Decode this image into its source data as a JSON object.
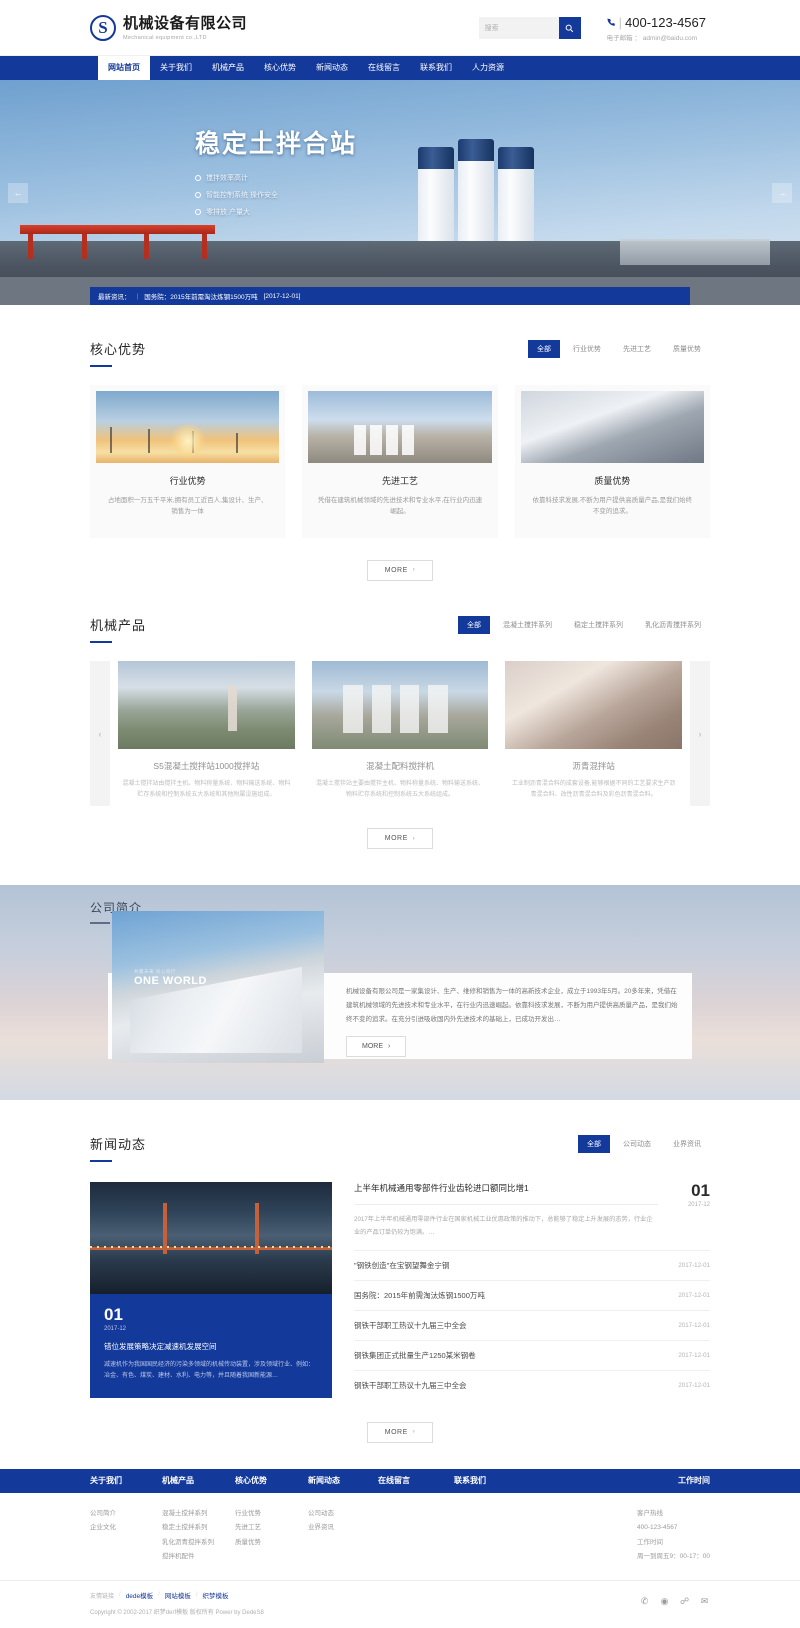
{
  "brand": {
    "logo_letter": "S",
    "name_cn": "机械设备有限公司",
    "name_en": "Mechanical equipment co.,LTD"
  },
  "search": {
    "placeholder": "搜索",
    "icon": "search-icon"
  },
  "contact": {
    "phone_icon": "phone-icon",
    "phone": "400-123-4567",
    "email_label": "电子邮箱",
    "email": "admin@baidu.com"
  },
  "nav": {
    "items": [
      {
        "label": "网站首页",
        "active": true
      },
      {
        "label": "关于我们",
        "active": false
      },
      {
        "label": "机械产品",
        "active": false
      },
      {
        "label": "核心优势",
        "active": false
      },
      {
        "label": "新闻动态",
        "active": false
      },
      {
        "label": "在线留言",
        "active": false
      },
      {
        "label": "联系我们",
        "active": false
      },
      {
        "label": "人力资源",
        "active": false
      }
    ]
  },
  "banner": {
    "title": "稳定土拌合站",
    "features": [
      "搅拌效率高计",
      "智能控制系统 操作安全",
      "零排放 产量大"
    ],
    "prev_icon": "arrow-left-icon",
    "prev_label": "←",
    "next_icon": "arrow-right-icon",
    "next_label": "→"
  },
  "ticker": {
    "label": "最新资讯：",
    "headline": "国务院：2015年前需淘汰炼钢1500万吨",
    "date": "[2017-12-01]"
  },
  "advantages": {
    "title": "核心优势",
    "tabs": [
      {
        "label": "全部",
        "active": true
      },
      {
        "label": "行业优势",
        "active": false
      },
      {
        "label": "先进工艺",
        "active": false
      },
      {
        "label": "质量优势",
        "active": false
      }
    ],
    "cards": [
      {
        "title": "行业优势",
        "desc": "占地面积一万五千平米,拥有员工近百人,集设计、生产、销售为一体"
      },
      {
        "title": "先进工艺",
        "desc": "凭借在建筑机械领域的先进技术和专业水平,在行业内迅速崛起。"
      },
      {
        "title": "质量优势",
        "desc": "依靠科技求发展,不断为用户提供高质量产品,是我们始终不变的追求。"
      }
    ],
    "more_label": "MORE"
  },
  "products": {
    "title": "机械产品",
    "tabs": [
      {
        "label": "全部",
        "active": true
      },
      {
        "label": "混凝土搅拌系列",
        "active": false
      },
      {
        "label": "稳定土搅拌系列",
        "active": false
      },
      {
        "label": "乳化沥青搅拌系列",
        "active": false
      }
    ],
    "prev_label": "‹",
    "next_label": "›",
    "items": [
      {
        "title": "S5混凝土搅拌站1000搅拌站",
        "desc": "混凝土搅拌站由搅拌主机、物料称量系统、物料输送系统、物料贮存系统和控制系统五大系统和其他附属设施组成。"
      },
      {
        "title": "混凝土配料搅拌机",
        "desc": "混凝土搅拌站主要由搅拌主机、物料称量系统、物料输送系统、物料贮存系统和控制系统五大系统组成。"
      },
      {
        "title": "沥青混拌站",
        "desc": "工业制沥青混合料的成套设备,能够根据不同的工艺要求生产沥青混合料、改性沥青混合料及彩色沥青混合料。"
      }
    ],
    "more_label": "MORE"
  },
  "about": {
    "title": "公司简介",
    "photo_sub": "共赢未来 同心同行",
    "photo_title": "ONE WORLD",
    "text": "机械设备有限公司是一家集设计、生产、维修和销售为一体的高新技术企业，成立于1993年5月。20多年来，凭借在建筑机械领域的先进技术和专业水平，在行业内迅速崛起。依靠科技求发展，不断为用户提供高质量产品，是我们始终不变的追求。在充分引进吸收国内外先进技术的基础上，已成功开发出…",
    "more_label": "MORE"
  },
  "news": {
    "title": "新闻动态",
    "tabs": [
      {
        "label": "全部",
        "active": true
      },
      {
        "label": "公司动态",
        "active": false
      },
      {
        "label": "业界资讯",
        "active": false
      }
    ],
    "featured": {
      "day": "01",
      "year_month": "2017-12",
      "title": "错位发展策略决定减速机发展空间",
      "desc": "减速机作为我国国民经济的污染多领域的机械传动装置，涉及领域行业、例如：冶金、有色、煤炭、建材、水利、电力等，并且随着我国新能源…"
    },
    "top": {
      "title": "上半年机械通用零部件行业齿轮进口额同比增1",
      "desc": "2017年上半年机械通用零部件行业在国家机械工业优惠政策的推动下，总能够了稳定上升发展的态势，行业企业的产品订单仍较为饱满。…",
      "day": "01",
      "year_month": "2017-12"
    },
    "list": [
      {
        "title": "\"钢铁创造\"在宝钢望舞金宁钢",
        "date": "2017-12-01"
      },
      {
        "title": "国务院：2015年前需淘汰炼钢1500万吨",
        "date": "2017-12-01"
      },
      {
        "title": "钢铁干部职工热议十九届三中全会",
        "date": "2017-12-01"
      },
      {
        "title": "钢铁集团正式批量生产1250某米钢卷",
        "date": "2017-12-01"
      },
      {
        "title": "钢铁干部职工热议十九届三中全会",
        "date": "2017-12-01"
      }
    ],
    "more_label": "MORE"
  },
  "footer": {
    "nav": [
      "关于我们",
      "机械产品",
      "核心优势",
      "新闻动态",
      "在线留言",
      "联系我们"
    ],
    "hours_heading": "工作时间",
    "columns": [
      {
        "links": [
          "公司简介",
          "企业文化"
        ]
      },
      {
        "links": [
          "混凝土搅拌系列",
          "稳定土搅拌系列",
          "乳化沥青搅拌系列",
          "搅拌机配件"
        ]
      },
      {
        "links": [
          "行业优势",
          "先进工艺",
          "质量优势"
        ]
      },
      {
        "links": [
          "公司动态",
          "业界资讯"
        ]
      },
      {
        "links": []
      },
      {
        "links": []
      }
    ],
    "hours": {
      "line1": "客户热线",
      "line2": "400-123-4567",
      "line3": "工作时间",
      "line4": "周一到周五9：00-17：00"
    },
    "friend_label": "友情链接",
    "friend_links": [
      "dede模板",
      "网站模板",
      "织梦模板"
    ],
    "copyright": "Copyright © 2002-2017 织梦derf模板 版权所有  Power by DedeS8",
    "social": [
      {
        "icon": "wechat-icon",
        "glyph": "✆"
      },
      {
        "icon": "weibo-icon",
        "glyph": "◉"
      },
      {
        "icon": "qq-icon",
        "glyph": "☍"
      },
      {
        "icon": "mail-icon",
        "glyph": "✉"
      }
    ]
  },
  "colors": {
    "brand": "#13399b",
    "text": "#333333",
    "muted": "#9b9b9b"
  }
}
